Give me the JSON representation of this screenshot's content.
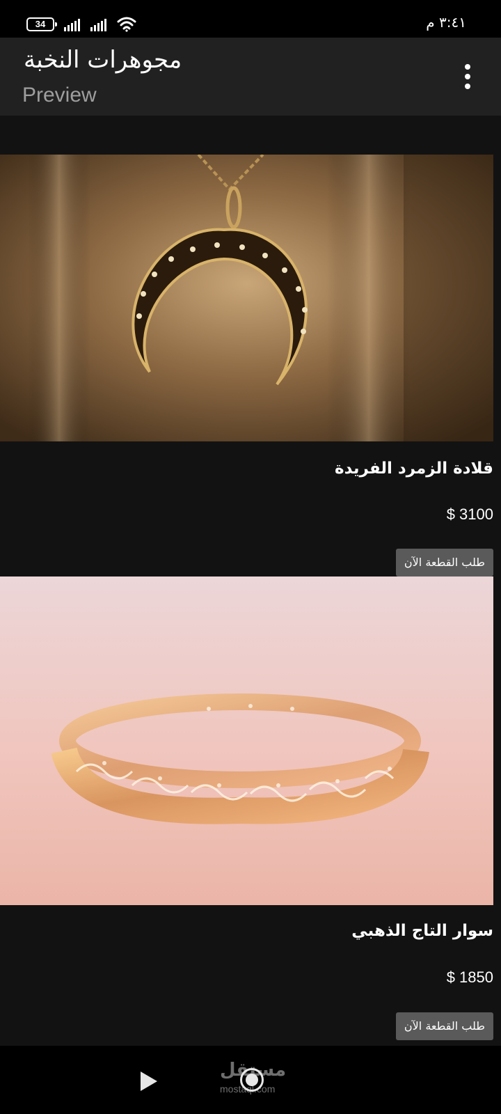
{
  "status_bar": {
    "battery": "34",
    "time": "٣:٤١ م",
    "icons": [
      "battery-icon",
      "signal-icon",
      "signal-icon",
      "wifi-icon"
    ]
  },
  "app_bar": {
    "title": "مجوهرات النخبة",
    "subtitle": "Preview",
    "menu_icon": "more-vert-icon"
  },
  "products": [
    {
      "name": "قلادة الزمرد الفريدة",
      "price": "$ 3100",
      "button_label": "طلب القطعة الآن"
    },
    {
      "name": "سوار التاج الذهبي",
      "price": "$ 1850",
      "button_label": "طلب القطعة الآن"
    }
  ],
  "bottom_bar": {
    "play_icon": "play-icon",
    "home_icon": "home-circle-icon",
    "watermark": "مستقل",
    "watermark_sub": "mostaql.com"
  },
  "colors": {
    "background": "#121212",
    "app_bar": "#212121",
    "status_bar": "#000000",
    "button": "#5a5a5a",
    "subtitle": "#9e9e9e"
  }
}
